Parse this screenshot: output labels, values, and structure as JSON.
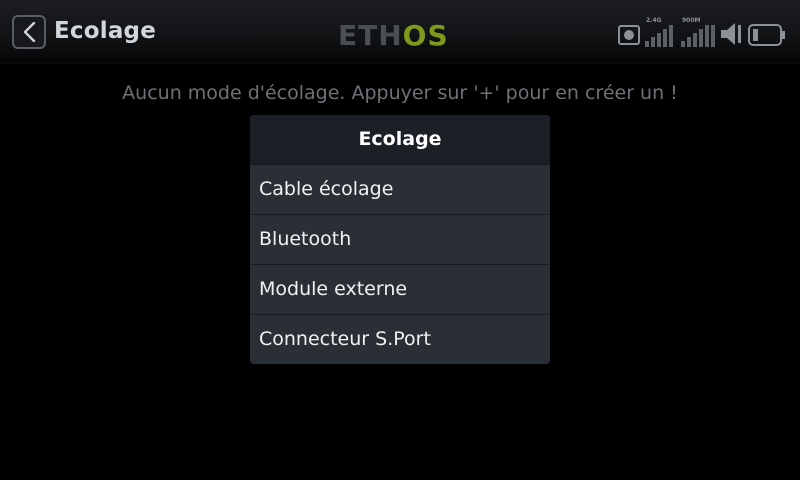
{
  "header": {
    "title": "Ecolage",
    "brand": "ETHOS",
    "back_icon": "chevron-left-icon"
  },
  "status": {
    "rf_2g4_label": "2.4G",
    "rf_900m_label": "900M",
    "icons": [
      "record-indicator-icon",
      "signal-2g4-icon",
      "signal-900m-icon",
      "volume-icon",
      "battery-icon"
    ]
  },
  "main": {
    "message": "Aucun mode d'écolage. Appuyer sur '+' pour en créer un !"
  },
  "dialog": {
    "title": "Ecolage",
    "items": [
      {
        "label": "Cable écolage"
      },
      {
        "label": "Bluetooth"
      },
      {
        "label": "Module externe"
      },
      {
        "label": "Connecteur S.Port"
      }
    ]
  },
  "colors": {
    "brand_gray": "#4b4e53",
    "brand_green": "#7e9a1d",
    "background": "#000000",
    "dialog_header": "#1b2026",
    "dialog_body": "#2a2f35"
  }
}
